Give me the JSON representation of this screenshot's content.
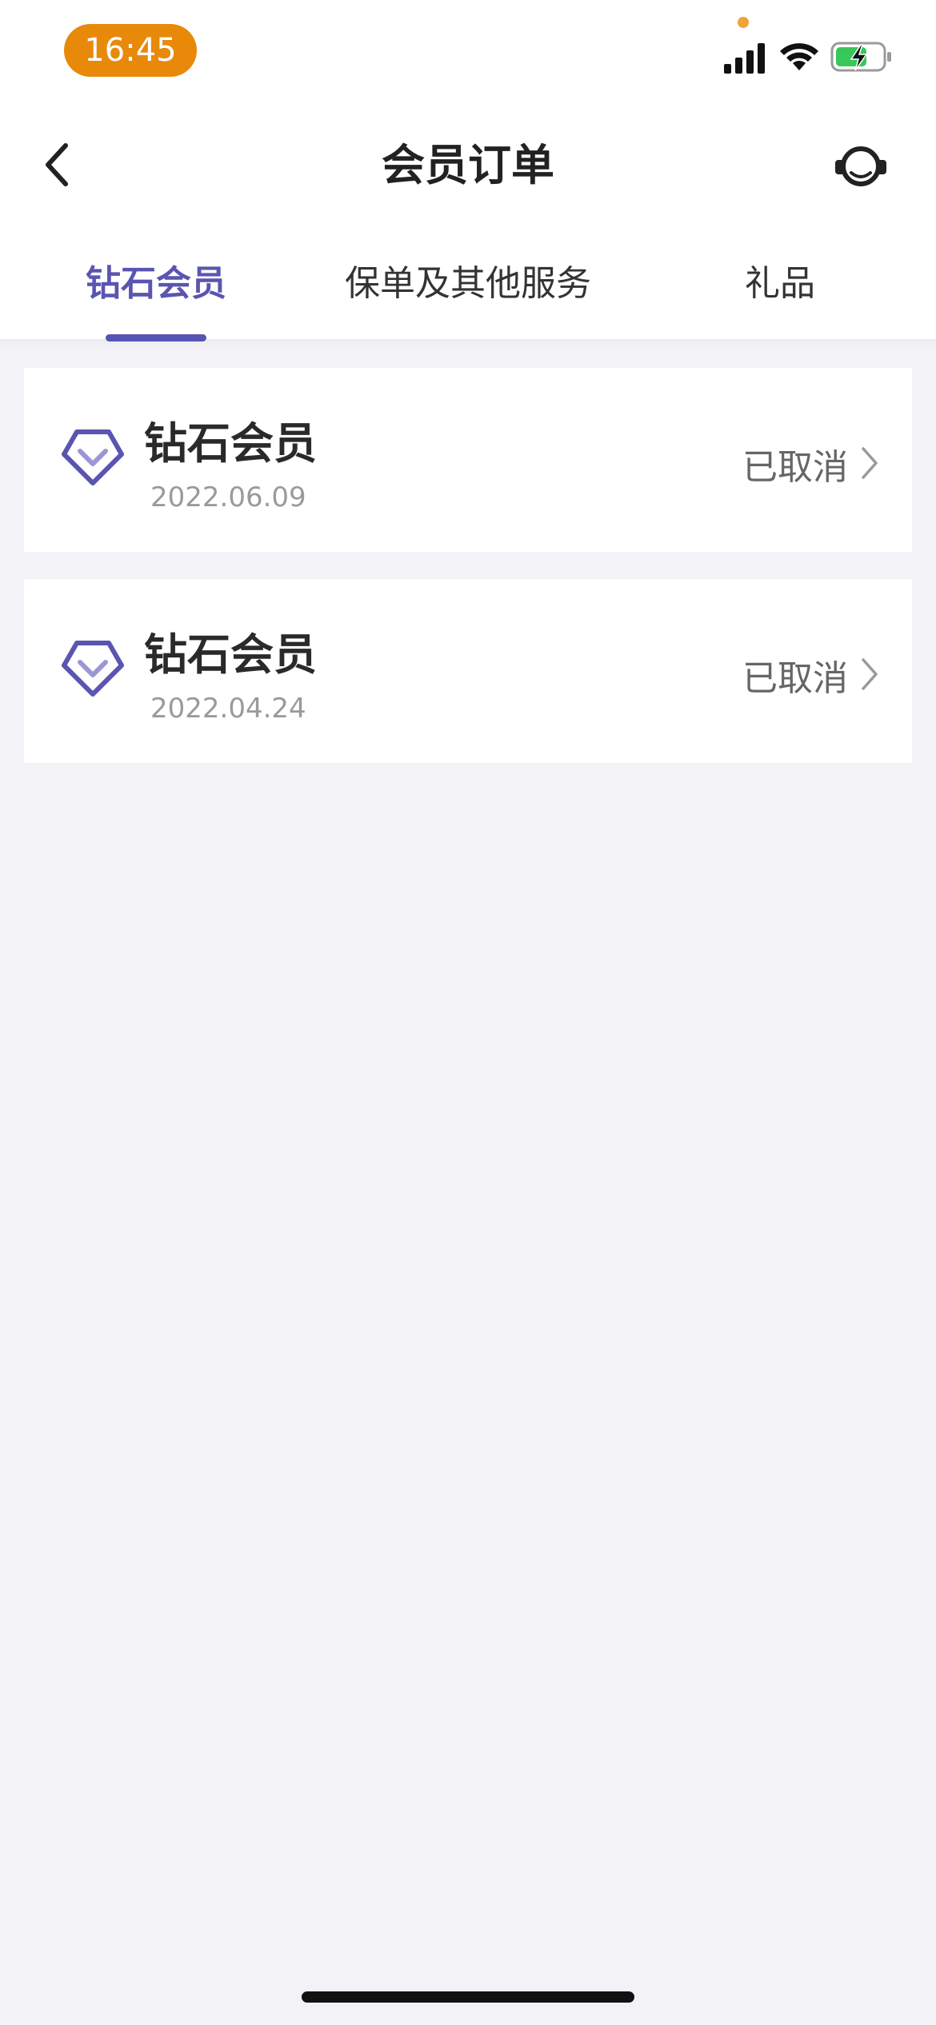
{
  "status_bar": {
    "time": "16:45"
  },
  "nav": {
    "title": "会员订单"
  },
  "tabs": [
    {
      "label": "钻石会员",
      "active": true
    },
    {
      "label": "保单及其他服务",
      "active": false
    },
    {
      "label": "礼品",
      "active": false
    }
  ],
  "orders": [
    {
      "name": "钻石会员",
      "date": "2022.06.09",
      "status": "已取消",
      "icon": "diamond-icon"
    },
    {
      "name": "钻石会员",
      "date": "2022.04.24",
      "status": "已取消",
      "icon": "diamond-icon"
    }
  ],
  "colors": {
    "accent": "#5753b3",
    "time_pill": "#e8890a",
    "background": "#f2f2f7"
  }
}
